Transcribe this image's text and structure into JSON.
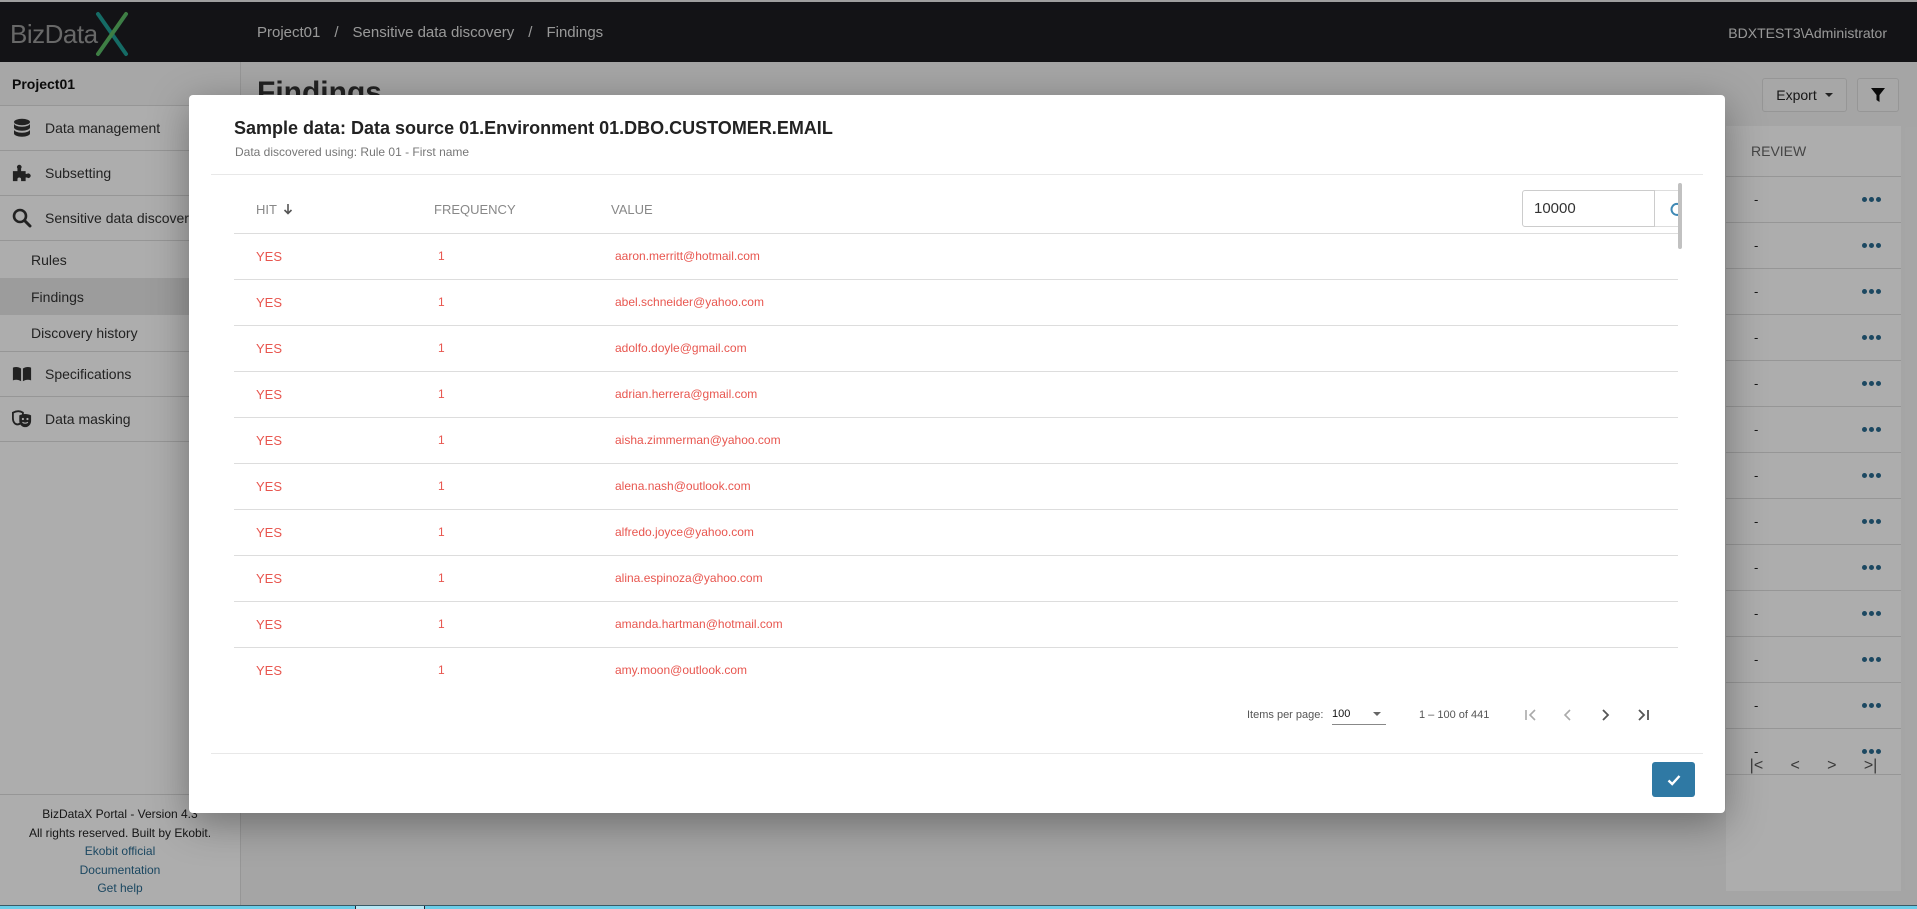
{
  "app": {
    "logo_text": "BizData",
    "logo_accent": "X",
    "user": "BDXTEST3\\Administrator"
  },
  "breadcrumb": [
    "Project01",
    "Sensitive data discovery",
    "Findings"
  ],
  "sidebar": {
    "project": "Project01",
    "items": [
      {
        "label": "Data management",
        "icon": "database-icon"
      },
      {
        "label": "Subsetting",
        "icon": "puzzle-icon"
      },
      {
        "label": "Sensitive data discovery",
        "icon": "search-icon"
      },
      {
        "label": "Specifications",
        "icon": "book-icon"
      },
      {
        "label": "Data masking",
        "icon": "masks-icon"
      }
    ],
    "subitems": [
      {
        "label": "Rules",
        "active": false
      },
      {
        "label": "Findings",
        "active": true
      },
      {
        "label": "Discovery history",
        "active": false
      }
    ],
    "footer": {
      "version": "BizDataX Portal - Version 4.3",
      "rights": "All rights reserved. Built by Ekobit.",
      "links": [
        "Ekobit official",
        "Documentation",
        "Get help"
      ]
    }
  },
  "main": {
    "title": "Findings",
    "export_label": "Export",
    "review_header": "REVIEW",
    "review_rows": [
      "-",
      "-",
      "-",
      "-",
      "-",
      "-",
      "-",
      "-",
      "-",
      "-",
      "-",
      "-",
      "-"
    ]
  },
  "modal": {
    "title": "Sample data: Data source 01.Environment 01.DBO.CUSTOMER.EMAIL",
    "subtitle": "Data discovered using: Rule 01 - First name",
    "columns": {
      "hit": "HIT",
      "frequency": "FREQUENCY",
      "value": "VALUE"
    },
    "sort_indicator": "arrow-down",
    "limit_value": "10000",
    "rows": [
      {
        "hit": "YES",
        "frequency": "1",
        "value": "aaron.merritt@hotmail.com"
      },
      {
        "hit": "YES",
        "frequency": "1",
        "value": "abel.schneider@yahoo.com"
      },
      {
        "hit": "YES",
        "frequency": "1",
        "value": "adolfo.doyle@gmail.com"
      },
      {
        "hit": "YES",
        "frequency": "1",
        "value": "adrian.herrera@gmail.com"
      },
      {
        "hit": "YES",
        "frequency": "1",
        "value": "aisha.zimmerman@yahoo.com"
      },
      {
        "hit": "YES",
        "frequency": "1",
        "value": "alena.nash@outlook.com"
      },
      {
        "hit": "YES",
        "frequency": "1",
        "value": "alfredo.joyce@yahoo.com"
      },
      {
        "hit": "YES",
        "frequency": "1",
        "value": "alina.espinoza@yahoo.com"
      },
      {
        "hit": "YES",
        "frequency": "1",
        "value": "amanda.hartman@hotmail.com"
      },
      {
        "hit": "YES",
        "frequency": "1",
        "value": "amy.moon@outlook.com"
      }
    ],
    "pager": {
      "items_per_page_label": "Items per page:",
      "items_per_page": "100",
      "range": "1 – 100 of 441"
    }
  },
  "colors": {
    "accent": "#2f79a4",
    "hit_text": "#e8564f",
    "topbar": "#1c1d21"
  }
}
